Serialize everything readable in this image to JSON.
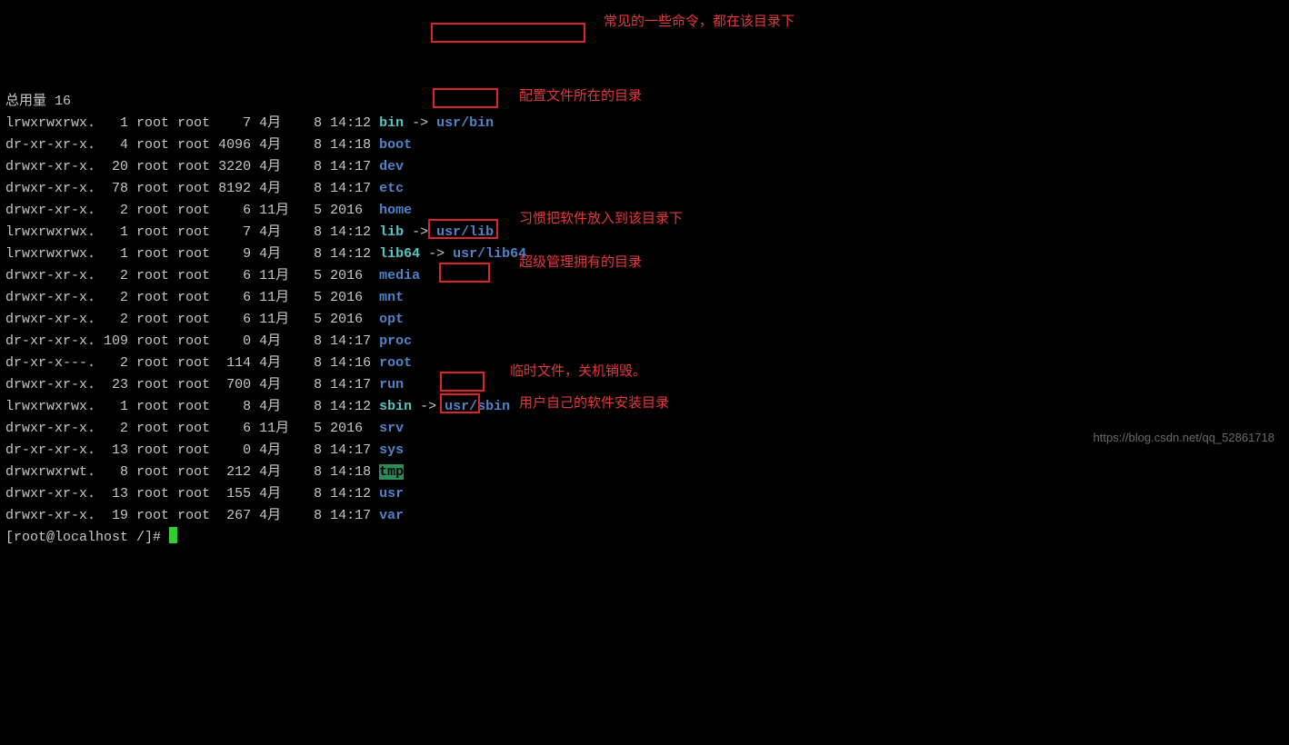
{
  "header": "总用量 16",
  "rows": [
    {
      "perm": "lrwxrwxrwx.",
      "links": "1",
      "owner": "root",
      "group": "root",
      "size": "7",
      "month": "4月",
      "day": "8",
      "time": "14:12",
      "name": "bin",
      "link": true,
      "target": "usr/bin"
    },
    {
      "perm": "dr-xr-xr-x.",
      "links": "4",
      "owner": "root",
      "group": "root",
      "size": "4096",
      "month": "4月",
      "day": "8",
      "time": "14:18",
      "name": "boot"
    },
    {
      "perm": "drwxr-xr-x.",
      "links": "20",
      "owner": "root",
      "group": "root",
      "size": "3220",
      "month": "4月",
      "day": "8",
      "time": "14:17",
      "name": "dev"
    },
    {
      "perm": "drwxr-xr-x.",
      "links": "78",
      "owner": "root",
      "group": "root",
      "size": "8192",
      "month": "4月",
      "day": "8",
      "time": "14:17",
      "name": "etc"
    },
    {
      "perm": "drwxr-xr-x.",
      "links": "2",
      "owner": "root",
      "group": "root",
      "size": "6",
      "month": "11月",
      "day": "5",
      "time": "2016",
      "name": "home"
    },
    {
      "perm": "lrwxrwxrwx.",
      "links": "1",
      "owner": "root",
      "group": "root",
      "size": "7",
      "month": "4月",
      "day": "8",
      "time": "14:12",
      "name": "lib",
      "link": true,
      "target": "usr/lib"
    },
    {
      "perm": "lrwxrwxrwx.",
      "links": "1",
      "owner": "root",
      "group": "root",
      "size": "9",
      "month": "4月",
      "day": "8",
      "time": "14:12",
      "name": "lib64",
      "link": true,
      "target": "usr/lib64"
    },
    {
      "perm": "drwxr-xr-x.",
      "links": "2",
      "owner": "root",
      "group": "root",
      "size": "6",
      "month": "11月",
      "day": "5",
      "time": "2016",
      "name": "media"
    },
    {
      "perm": "drwxr-xr-x.",
      "links": "2",
      "owner": "root",
      "group": "root",
      "size": "6",
      "month": "11月",
      "day": "5",
      "time": "2016",
      "name": "mnt"
    },
    {
      "perm": "drwxr-xr-x.",
      "links": "2",
      "owner": "root",
      "group": "root",
      "size": "6",
      "month": "11月",
      "day": "5",
      "time": "2016",
      "name": "opt"
    },
    {
      "perm": "dr-xr-xr-x.",
      "links": "109",
      "owner": "root",
      "group": "root",
      "size": "0",
      "month": "4月",
      "day": "8",
      "time": "14:17",
      "name": "proc"
    },
    {
      "perm": "dr-xr-x---.",
      "links": "2",
      "owner": "root",
      "group": "root",
      "size": "114",
      "month": "4月",
      "day": "8",
      "time": "14:16",
      "name": "root"
    },
    {
      "perm": "drwxr-xr-x.",
      "links": "23",
      "owner": "root",
      "group": "root",
      "size": "700",
      "month": "4月",
      "day": "8",
      "time": "14:17",
      "name": "run"
    },
    {
      "perm": "lrwxrwxrwx.",
      "links": "1",
      "owner": "root",
      "group": "root",
      "size": "8",
      "month": "4月",
      "day": "8",
      "time": "14:12",
      "name": "sbin",
      "link": true,
      "target": "usr/sbin"
    },
    {
      "perm": "drwxr-xr-x.",
      "links": "2",
      "owner": "root",
      "group": "root",
      "size": "6",
      "month": "11月",
      "day": "5",
      "time": "2016",
      "name": "srv"
    },
    {
      "perm": "dr-xr-xr-x.",
      "links": "13",
      "owner": "root",
      "group": "root",
      "size": "0",
      "month": "4月",
      "day": "8",
      "time": "14:17",
      "name": "sys"
    },
    {
      "perm": "drwxrwxrwt.",
      "links": "8",
      "owner": "root",
      "group": "root",
      "size": "212",
      "month": "4月",
      "day": "8",
      "time": "14:18",
      "name": "tmp",
      "tmp": true
    },
    {
      "perm": "drwxr-xr-x.",
      "links": "13",
      "owner": "root",
      "group": "root",
      "size": "155",
      "month": "4月",
      "day": "8",
      "time": "14:12",
      "name": "usr"
    },
    {
      "perm": "drwxr-xr-x.",
      "links": "19",
      "owner": "root",
      "group": "root",
      "size": "267",
      "month": "4月",
      "day": "8",
      "time": "14:17",
      "name": "var"
    }
  ],
  "prompt": "[root@localhost /]# ",
  "notes": {
    "bin": "常见的一些命令，都在该目录下",
    "etc": "配置文件所在的目录",
    "opt": "习惯把软件放入到该目录下",
    "root": "超级管理拥有的目录",
    "tmp": "临时文件，关机销毁。",
    "usr": "用户自己的软件安装目录"
  },
  "watermark": "https://blog.csdn.net/qq_52861718"
}
